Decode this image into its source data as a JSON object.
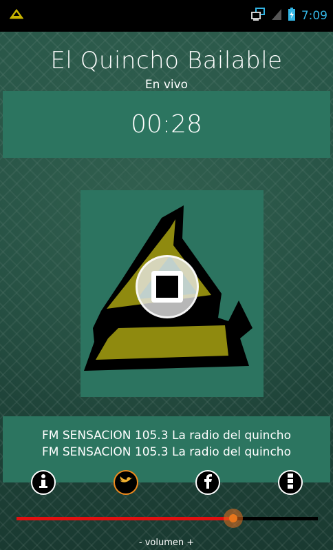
{
  "status_bar": {
    "time": "7:09",
    "icons": [
      "app-logo-icon",
      "network-icon",
      "signal-icon",
      "battery-icon"
    ]
  },
  "header": {
    "title": "El Quincho Bailable",
    "subtitle": "En vivo"
  },
  "player": {
    "elapsed": "00:28",
    "stop_icon": "stop-icon"
  },
  "now_playing": {
    "line1": "FM SENSACION 105.3 La radio del quincho",
    "line2": "FM SENSACION 105.3 La radio del quincho"
  },
  "actions": [
    {
      "name": "info-icon",
      "label": "i"
    },
    {
      "name": "twitter-icon",
      "label": ""
    },
    {
      "name": "facebook-icon",
      "label": "f"
    },
    {
      "name": "menu-icon",
      "label": ""
    }
  ],
  "volume": {
    "label": "- volumen +",
    "level_percent": 72,
    "fill_color": "#e01010",
    "thumb_color": "#e8761c"
  },
  "colors": {
    "panel": "#2c7560",
    "status_time": "#33b5e5",
    "logo_yellow": "#8f8a0f"
  }
}
